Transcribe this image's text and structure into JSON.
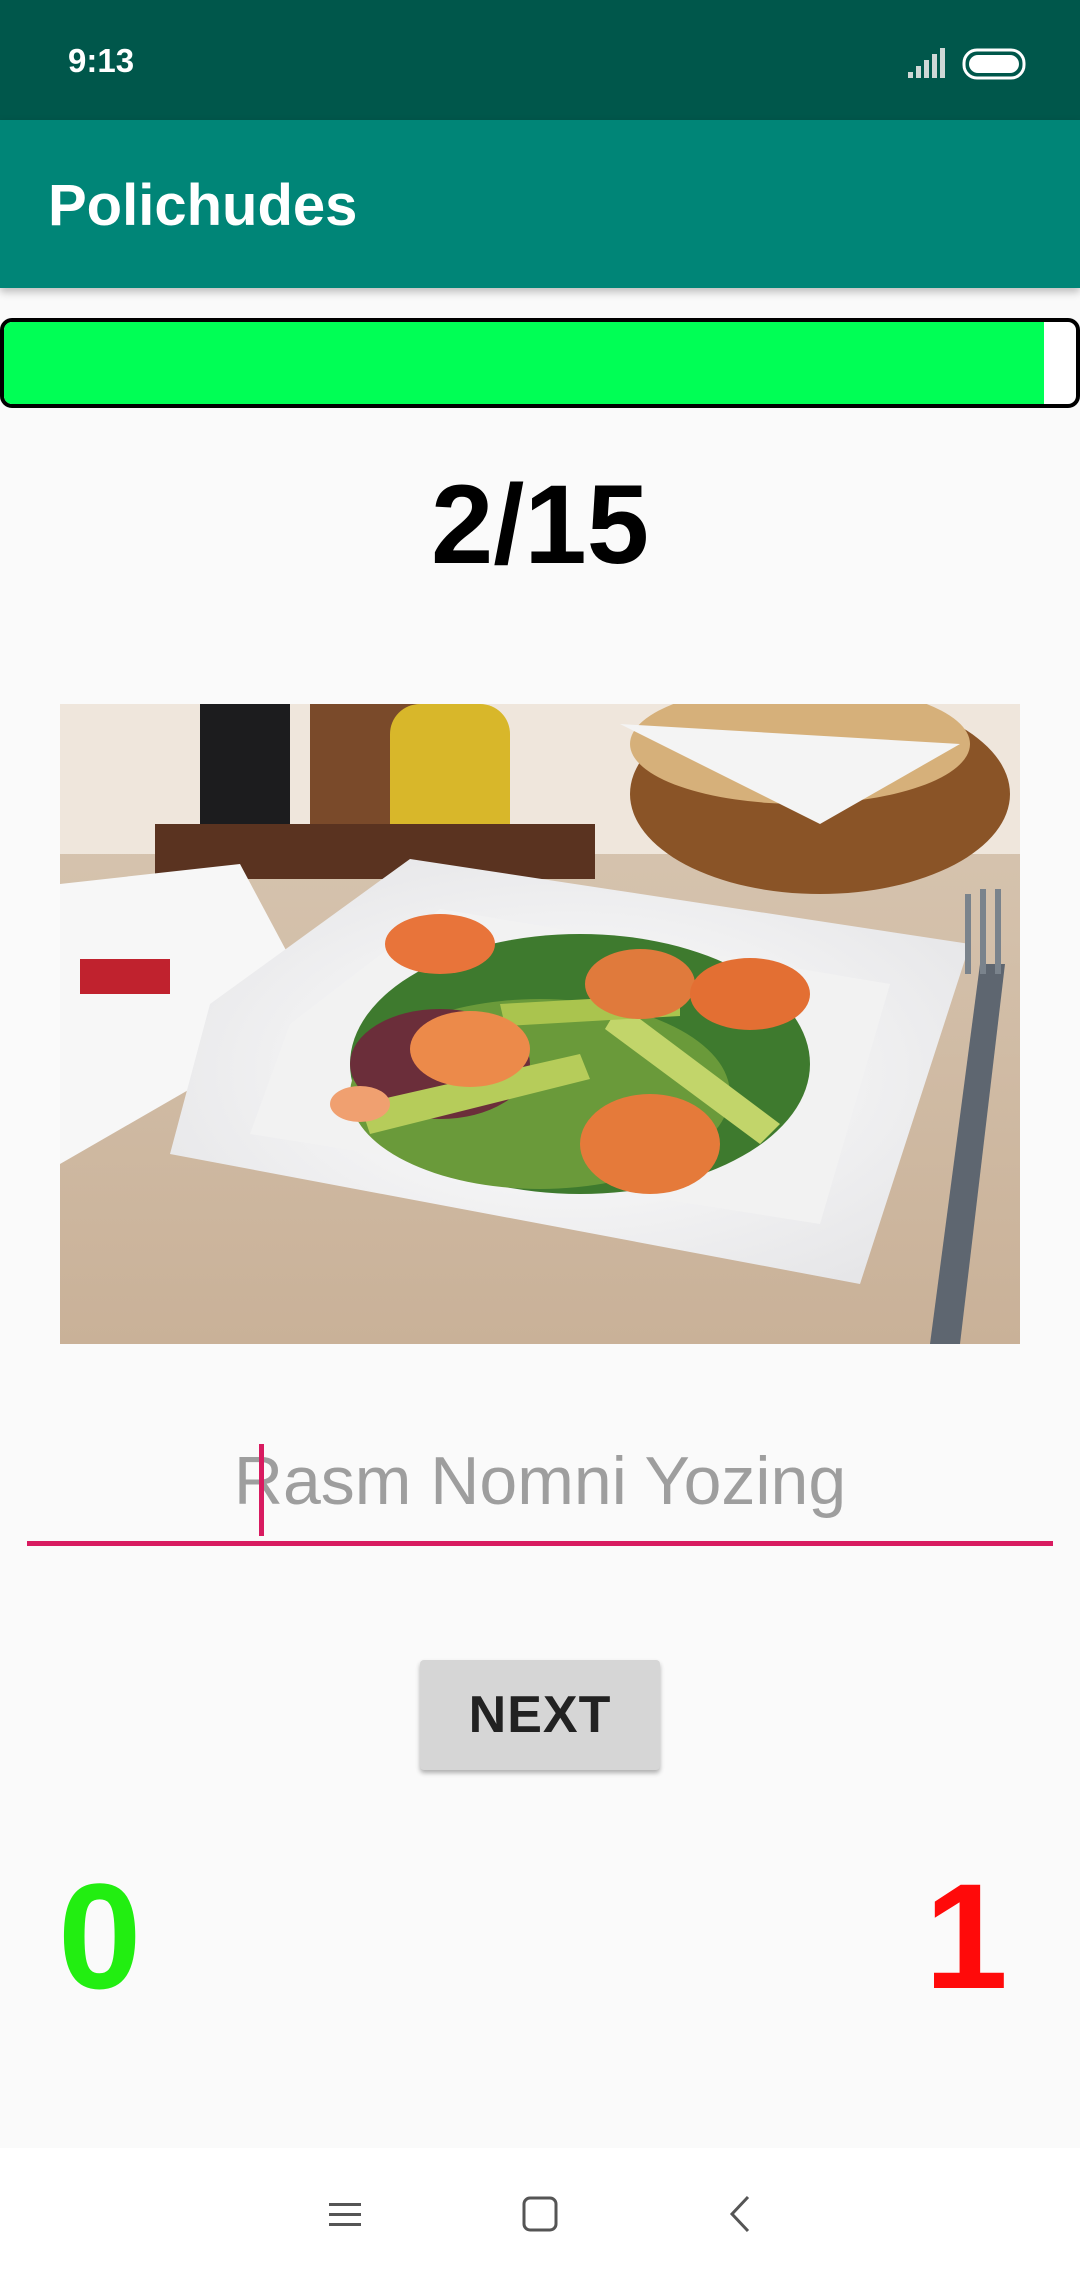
{
  "status_bar": {
    "time": "9:13",
    "icons": [
      "signal-icon",
      "battery-icon"
    ]
  },
  "app_bar": {
    "title": "Polichudes",
    "color": "#008577"
  },
  "quiz": {
    "progress_fraction": 0.97,
    "progress_color": "#00ff55",
    "counter": "2/15",
    "image_subject": "shrimp-avocado-salad-photo",
    "answer": {
      "value": "",
      "placeholder": "Rasm Nomni Yozing"
    },
    "next_label": "NEXT",
    "correct_score": "0",
    "correct_color": "#22ee11",
    "wrong_score": "1",
    "wrong_color": "#ff0a0a"
  },
  "nav_bar": {
    "icons": [
      "menu-icon",
      "home-icon",
      "back-icon"
    ]
  }
}
